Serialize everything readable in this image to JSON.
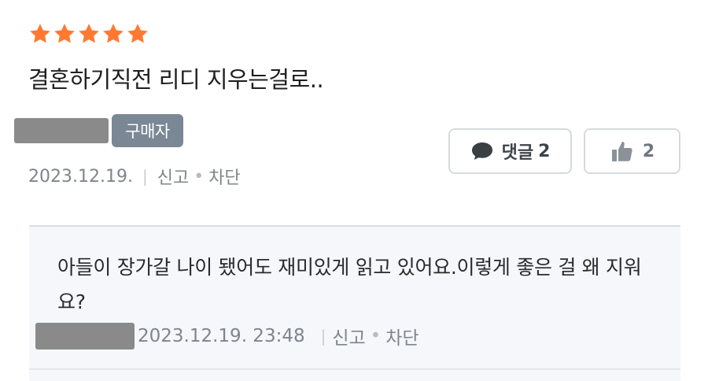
{
  "review": {
    "rating": 5,
    "star_color": "#ff7a30",
    "text": "결혼하기직전 리디 지우는걸로..",
    "buyer_badge": "구매자",
    "date": "2023.12.19.",
    "report_label": "신고",
    "block_label": "차단",
    "comment_button": {
      "label": "댓글",
      "count": "2",
      "icon": "speech-bubble-icon"
    },
    "like_button": {
      "count": "2",
      "icon": "thumbs-up-icon"
    }
  },
  "comment": {
    "text": "아들이 장가갈 나이 됐어도 재미있게 읽고 있어요.이렇게 좋은 걸 왜 지워요?",
    "datetime": "2023.12.19. 23:48",
    "report_label": "신고",
    "block_label": "차단"
  }
}
